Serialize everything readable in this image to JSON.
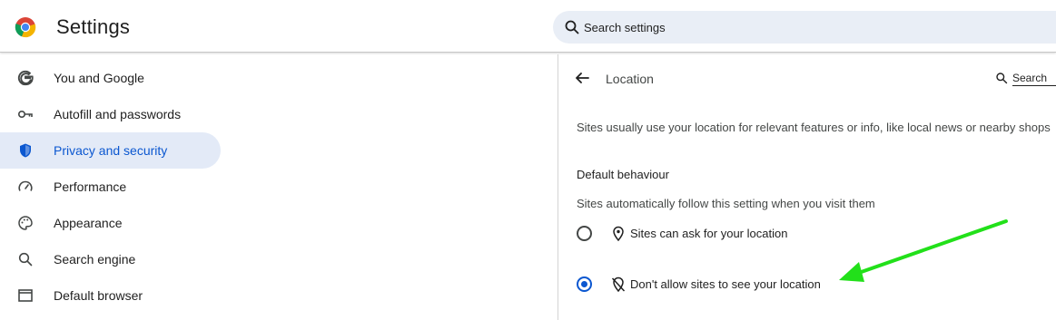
{
  "header": {
    "app_title": "Settings",
    "logo_icon": "chrome-logo-icon",
    "search_placeholder": "Search settings"
  },
  "sidebar": {
    "items": [
      {
        "label": "You and Google",
        "icon": "google-g-icon",
        "active": false
      },
      {
        "label": "Autofill and passwords",
        "icon": "key-icon",
        "active": false
      },
      {
        "label": "Privacy and security",
        "icon": "shield-icon",
        "active": true
      },
      {
        "label": "Performance",
        "icon": "speedometer-icon",
        "active": false
      },
      {
        "label": "Appearance",
        "icon": "palette-icon",
        "active": false
      },
      {
        "label": "Search engine",
        "icon": "search-icon",
        "active": false
      },
      {
        "label": "Default browser",
        "icon": "browser-window-icon",
        "active": false
      }
    ]
  },
  "main": {
    "title": "Location",
    "mini_search_label": "Search",
    "description": "Sites usually use your location for relevant features or info, like local news or nearby shops",
    "default_behaviour": {
      "heading": "Default behaviour",
      "subtitle": "Sites automatically follow this setting when you visit them",
      "options": [
        {
          "label": "Sites can ask for your location",
          "icon": "location-pin-icon",
          "selected": false
        },
        {
          "label": "Don't allow sites to see your location",
          "icon": "location-off-icon",
          "selected": true
        }
      ]
    }
  },
  "colors": {
    "accent": "#0b57d0",
    "active_bg": "#e3eaf7",
    "search_bg": "#e9eef6",
    "annotation_arrow": "#22e01a"
  }
}
